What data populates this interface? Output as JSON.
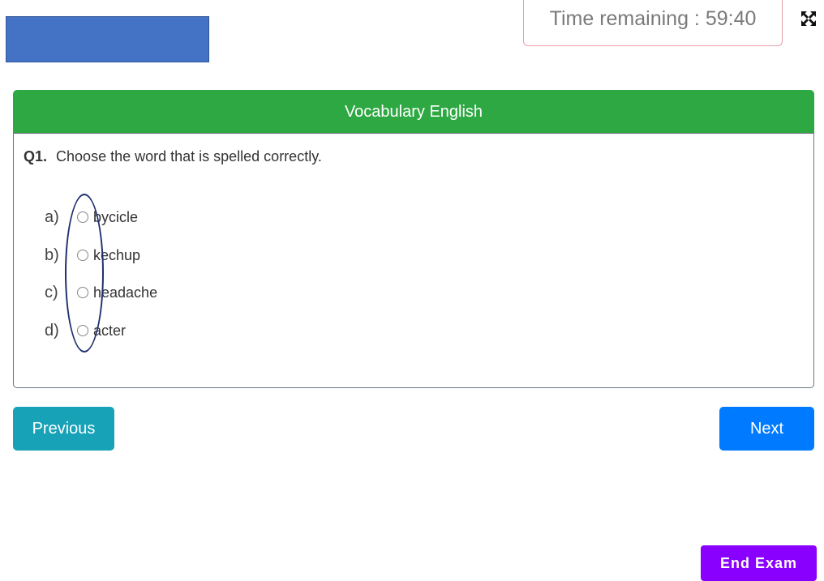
{
  "header": {
    "timer_text": "Time remaining : 59:40",
    "fullscreen_icon": "expand-arrows-icon"
  },
  "section": {
    "title": "Vocabulary English"
  },
  "question": {
    "number": "Q1.",
    "text": "Choose the word that is spelled correctly.",
    "options": [
      {
        "letter": "a)",
        "label": "bycicle"
      },
      {
        "letter": "b)",
        "label": "kechup"
      },
      {
        "letter": "c)",
        "label": "headache"
      },
      {
        "letter": "d)",
        "label": "acter"
      }
    ]
  },
  "nav": {
    "previous_label": "Previous",
    "next_label": "Next",
    "end_label": "End Exam"
  },
  "colors": {
    "header_green": "#2ea843",
    "previous": "#17a2b8",
    "next": "#007bff",
    "end_exam": "#8a00ff",
    "logo_blue": "#4472c4"
  }
}
